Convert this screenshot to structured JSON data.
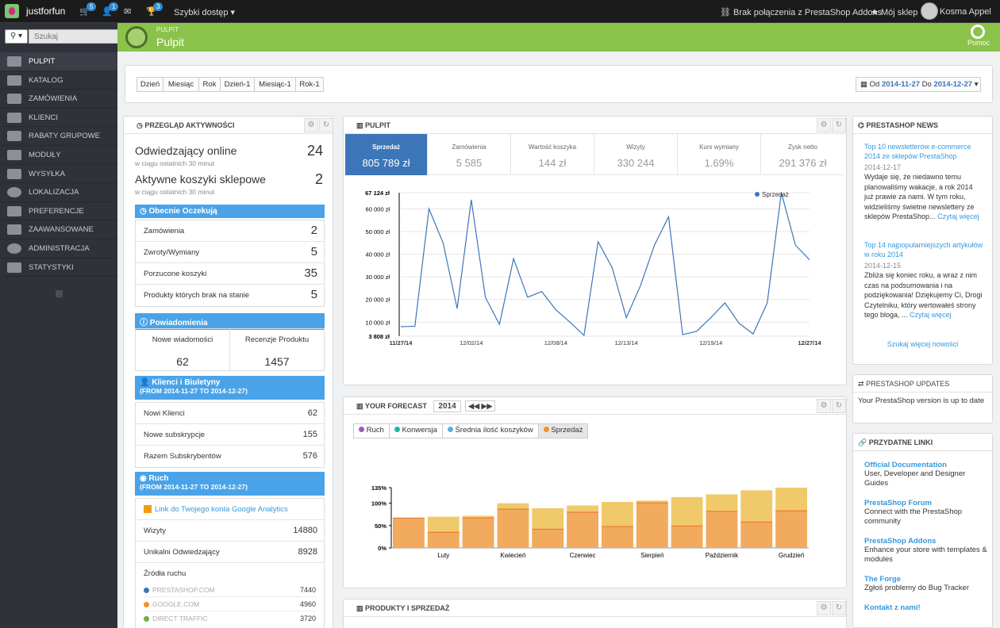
{
  "topbar": {
    "app_name": "justforfun",
    "badge_orders": "5",
    "badge_customers": "1",
    "badge_trophy": "3",
    "quick_access": "Szybki dostęp",
    "addons_status": "Brak połączenia z PrestaShop Addons",
    "my_shop": "Mój sklep",
    "user_name": "Kosma Appel"
  },
  "search": {
    "placeholder": "Szukaj"
  },
  "sidebar": {
    "items": [
      {
        "label": "PULPIT",
        "icon": "dashboard-icon"
      },
      {
        "label": "KATALOG",
        "icon": "book-icon"
      },
      {
        "label": "ZAMÓWIENIA",
        "icon": "credit-card-icon"
      },
      {
        "label": "KLIENCI",
        "icon": "users-icon"
      },
      {
        "label": "RABATY GRUPOWE",
        "icon": "tag-icon"
      },
      {
        "label": "MODUŁY",
        "icon": "puzzle-icon"
      },
      {
        "label": "WYSYŁKA",
        "icon": "truck-icon"
      },
      {
        "label": "LOKALIZACJA",
        "icon": "globe-icon"
      },
      {
        "label": "PREFERENCJE",
        "icon": "wrench-icon"
      },
      {
        "label": "ZAAWANSOWANE",
        "icon": "cogs-icon"
      },
      {
        "label": "ADMINISTRACJA",
        "icon": "cog-icon"
      },
      {
        "label": "STATYSTYKI",
        "icon": "bar-chart-icon"
      }
    ]
  },
  "header": {
    "breadcrumb": "PULPIT",
    "title": "Pulpit",
    "help": "Pomoc"
  },
  "range_buttons": [
    "Dzień",
    "Miesiąc",
    "Rok",
    "Dzień-1",
    "Miesiąc-1",
    "Rok-1"
  ],
  "date_range": {
    "prefix": "Od",
    "from": "2014-11-27",
    "middle": "Do",
    "to": "2014-12-27"
  },
  "activity": {
    "title": "PRZEGLĄD AKTYWNOŚCI",
    "online_label": "Odwiedzający online",
    "online_sub": "w ciągu ostatnich 30 minut",
    "online_value": "24",
    "carts_label": "Aktywne koszyki sklepowe",
    "carts_sub": "w ciągu ostatnich 30 minut",
    "carts_value": "2",
    "pending_title": "Obecnie Oczekują",
    "pending": [
      {
        "label": "Zamówienia",
        "value": "2"
      },
      {
        "label": "Zwroty/Wymiany",
        "value": "5"
      },
      {
        "label": "Porzucone koszyki",
        "value": "35"
      },
      {
        "label": "Produkty których brak na stanie",
        "value": "5"
      }
    ],
    "notif_title": "Powiadomienia",
    "notif_new_label": "Nowe wiadomości",
    "notif_new_value": "62",
    "notif_reviews_label": "Recenzje Produktu",
    "notif_reviews_value": "1457",
    "clients_title": "Klienci i Biuletyny",
    "clients_sub": "(FROM 2014-11-27 TO 2014-12-27)",
    "clients": [
      {
        "label": "Nowi Klienci",
        "value": "62"
      },
      {
        "label": "Nowe subskrypcje",
        "value": "155"
      },
      {
        "label": "Razem Subskrybentów",
        "value": "576"
      }
    ],
    "traffic_title": "Ruch",
    "traffic_sub": "(FROM 2014-11-27 TO 2014-12-27)",
    "ga_link": "Link do Twojego konta Google Analytics",
    "visits_label": "Wizyty",
    "visits_value": "14880",
    "unique_label": "Unikalni Odwiedzający",
    "unique_value": "8928",
    "sources_title": "Źródła ruchu",
    "sources": [
      {
        "label": "PRESTASHOP.COM",
        "value": "7440",
        "color": "#3c76b8"
      },
      {
        "label": "GOOGLE.COM",
        "value": "4960",
        "color": "#f0932b"
      },
      {
        "label": "DIRECT TRAFFIC",
        "value": "3720",
        "color": "#6ab04c"
      }
    ]
  },
  "dashboard": {
    "title": "PULPIT",
    "kpis": [
      {
        "label": "Sprzedaż",
        "value": "805 789 zł"
      },
      {
        "label": "Zamówienia",
        "value": "5 585"
      },
      {
        "label": "Wartość koszyka",
        "value": "144 zł"
      },
      {
        "label": "Wizyty",
        "value": "330 244"
      },
      {
        "label": "Kurs wymiany",
        "value": "1.69%"
      },
      {
        "label": "Zysk netto",
        "value": "291 376 zł"
      }
    ]
  },
  "forecast": {
    "title": "YOUR FORECAST",
    "year": "2014",
    "tabs": [
      {
        "label": "Ruch",
        "color": "#9b59b6"
      },
      {
        "label": "Konwersja",
        "color": "#1abc9c"
      },
      {
        "label": "Średnia ilość koszyków",
        "color": "#5dade2"
      },
      {
        "label": "Sprzedaż",
        "color": "#f0932b"
      }
    ]
  },
  "products": {
    "title": "PRODUKTY I SPRZEDAŻ"
  },
  "news": {
    "title": "PRESTASHOP NEWS",
    "items": [
      {
        "title": "Top 10 newsletterów e-commerce 2014 ze sklepów PrestaShop",
        "date": "2014-12-17",
        "body": "Wydaje się, że niedawno temu planowaliśmy wakacje, a rok 2014 już prawie za nami. W tym roku, widzieliśmy świetne newslettery ze sklepów PrestaShop...",
        "more": "Czytaj więcej"
      },
      {
        "title": "Top 14 najpopularniejszych artykułów w roku 2014",
        "date": "2014-12-15",
        "body": "Zbliża się koniec roku, a wraz z nim czas na podsumowania i na podziękowania! Dziękujemy Ci, Drogi Czytelniku, który wertowałeś strony tego bloga, ...",
        "more": "Czytaj więcej"
      }
    ],
    "find_more": "Szukaj więcej nowości"
  },
  "updates": {
    "title": "PRESTASHOP UPDATES",
    "text": "Your PrestaShop version is up to date"
  },
  "links": {
    "title": "PRZYDATNE LINKI",
    "items": [
      {
        "title": "Official Documentation",
        "desc": "User, Developer and Designer Guides"
      },
      {
        "title": "PrestaShop Forum",
        "desc": "Connect with the PrestaShop community"
      },
      {
        "title": "PrestaShop Addons",
        "desc": "Enhance your store with templates & modules"
      },
      {
        "title": "The Forge",
        "desc": "Zgłoś problemy do Bug Tracker"
      }
    ],
    "contact": "Kontakt z nami!"
  },
  "chart_data": [
    {
      "type": "line",
      "series": [
        {
          "name": "Sprzedaż",
          "color": "#3c76b8",
          "values": [
            8000,
            8200,
            60000,
            45000,
            16000,
            64000,
            21000,
            9000,
            38000,
            21000,
            23500,
            15500,
            10000,
            4200,
            45500,
            34000,
            12000,
            26000,
            44000,
            56500,
            4500,
            6000,
            12000,
            18500,
            9500,
            4800,
            18500,
            67124,
            44000,
            37500
          ]
        }
      ],
      "y_ticks": [
        "3 808 zł",
        "10 000 zł",
        "20 000 zł",
        "30 000 zł",
        "40 000 zł",
        "50 000 zł",
        "60 000 zł",
        "67 124 zł"
      ],
      "x_ticks": [
        "11/27/14",
        "12/02/14",
        "12/08/14",
        "12/13/14",
        "12/19/14",
        "12/27/14"
      ],
      "ylim": [
        3808,
        67124
      ]
    },
    {
      "type": "bar",
      "categories": [
        "Luty",
        "Kwiecień",
        "Czerwiec",
        "Sierpień",
        "Październik",
        "Grudzień"
      ],
      "series": [
        {
          "name": "Sprzedaż",
          "values": [
            67,
            70,
            72,
            100,
            89,
            95,
            103,
            106,
            114,
            120,
            129,
            135
          ]
        },
        {
          "name": "Sprzedaż",
          "values": [
            67,
            35,
            67,
            87,
            42,
            80,
            48,
            101,
            49,
            82,
            58,
            83
          ]
        }
      ],
      "y_ticks": [
        "0%",
        "50%",
        "100%",
        "135%"
      ],
      "ylim": [
        0,
        135
      ]
    }
  ]
}
